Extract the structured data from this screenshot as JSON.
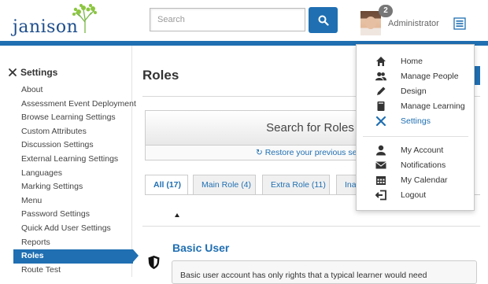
{
  "header": {
    "logo_text": "janison",
    "search_placeholder": "Search",
    "notification_count": "2",
    "user_name": "Administrator"
  },
  "sidebar": {
    "title": "Settings",
    "items": [
      {
        "label": "About"
      },
      {
        "label": "Assessment Event Deployment"
      },
      {
        "label": "Browse Learning Settings"
      },
      {
        "label": "Custom Attributes"
      },
      {
        "label": "Discussion Settings"
      },
      {
        "label": "External Learning Settings"
      },
      {
        "label": "Languages"
      },
      {
        "label": "Marking Settings"
      },
      {
        "label": "Menu"
      },
      {
        "label": "Password Settings"
      },
      {
        "label": "Quick Add User Settings"
      },
      {
        "label": "Reports"
      },
      {
        "label": "Roles"
      },
      {
        "label": "Route Test"
      }
    ],
    "active_item": "Roles"
  },
  "main": {
    "page_title": "Roles",
    "search_panel_title": "Search for Roles",
    "restore_link": "Restore your previous sea",
    "tabs": [
      {
        "label": "All (17)"
      },
      {
        "label": "Main Role (4)"
      },
      {
        "label": "Extra Role (11)"
      },
      {
        "label": "Ina"
      }
    ],
    "roles": [
      {
        "name": "Basic User",
        "description": "Basic user account has only rights that a typical learner would need"
      }
    ]
  },
  "dropdown": {
    "items": [
      {
        "label": "Home",
        "icon": "home-icon"
      },
      {
        "label": "Manage People",
        "icon": "people-icon"
      },
      {
        "label": "Design",
        "icon": "pencil-icon"
      },
      {
        "label": "Manage Learning",
        "icon": "book-icon"
      },
      {
        "label": "Settings",
        "icon": "tools-icon"
      },
      {
        "label": "My Account",
        "icon": "user-icon"
      },
      {
        "label": "Notifications",
        "icon": "envelope-icon"
      },
      {
        "label": "My Calendar",
        "icon": "calendar-icon"
      },
      {
        "label": "Logout",
        "icon": "logout-icon"
      }
    ],
    "active_item": "Settings"
  },
  "colors": {
    "brand_blue": "#1f6fb2",
    "logo_green": "#7ab648"
  }
}
